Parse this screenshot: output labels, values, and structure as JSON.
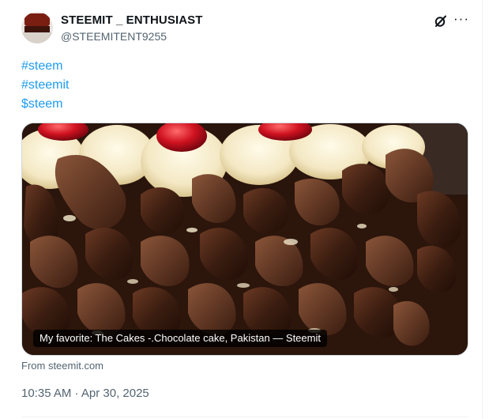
{
  "author": {
    "display_name": "STEEMIT _ ENTHUSIAST",
    "handle": "@STEEMITENT9255"
  },
  "header_icons": [
    "grok-icon",
    "more-icon"
  ],
  "tags": [
    "#steem",
    "#steemit",
    "$steem"
  ],
  "media": {
    "caption": "My favorite: The Cakes -.Chocolate cake, Pakistan — Steemit"
  },
  "source": "From steemit.com",
  "timestamp": "10:35 AM · Apr 30, 2025",
  "colors": {
    "link": "#1d9bf0",
    "secondary_text": "#536471",
    "primary_text": "#0f1419"
  }
}
